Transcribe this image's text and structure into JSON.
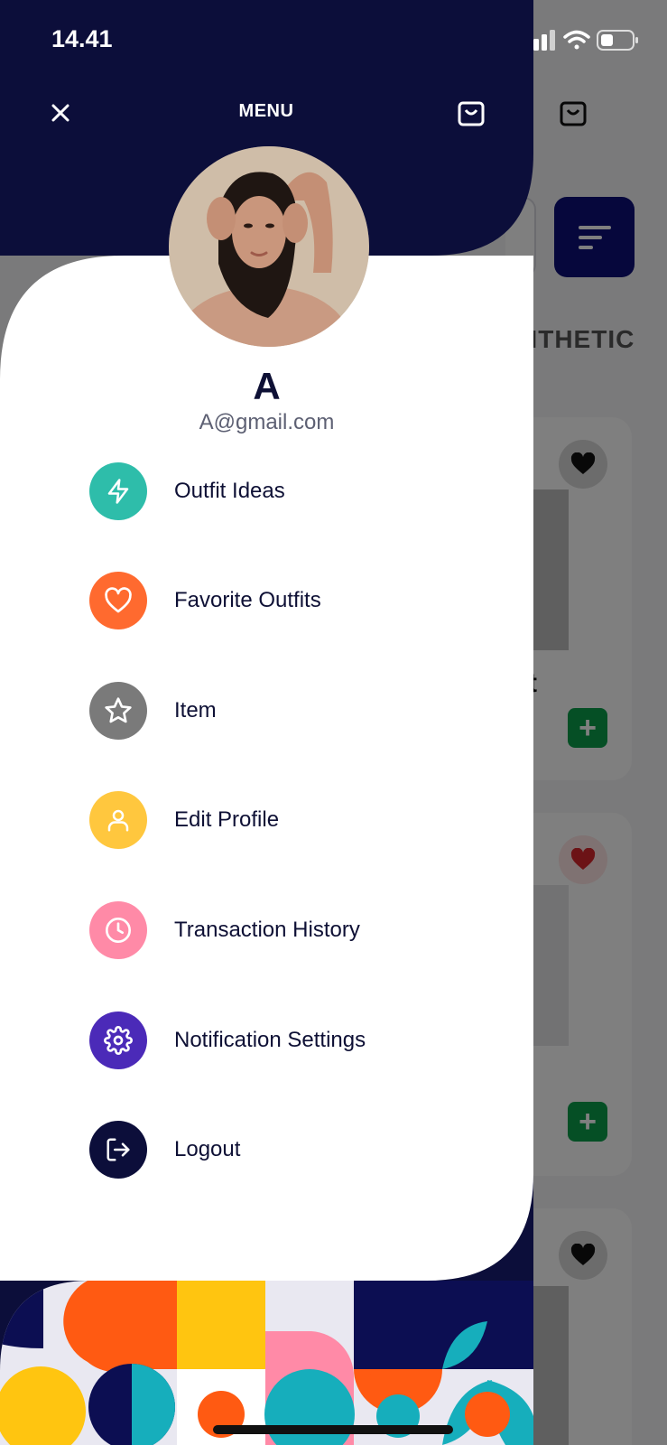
{
  "status_bar": {
    "time": "14.41"
  },
  "drawer": {
    "title": "MENU",
    "user": {
      "name": "A",
      "email": "A@gmail.com"
    },
    "items": [
      {
        "label": "Outfit Ideas",
        "icon": "lightning-icon",
        "color": "#2ebdaa"
      },
      {
        "label": "Favorite Outfits",
        "icon": "heart-icon",
        "color": "#ff6a2f"
      },
      {
        "label": "Item",
        "icon": "star-icon",
        "color": "#7a7a7a"
      },
      {
        "label": "Edit Profile",
        "icon": "user-icon",
        "color": "#ffc73e"
      },
      {
        "label": "Transaction History",
        "icon": "clock-icon",
        "color": "#ff8aa7"
      },
      {
        "label": "Notification Settings",
        "icon": "gear-icon",
        "color": "#4b2ab8"
      },
      {
        "label": "Logout",
        "icon": "logout-icon",
        "color": "#0c0e3a"
      }
    ],
    "colors": {
      "navy": "#0c0e3a",
      "white": "#ffffff"
    }
  },
  "background_app": {
    "category_fragment": "NTHETIC",
    "card_title_fragment": "t"
  }
}
